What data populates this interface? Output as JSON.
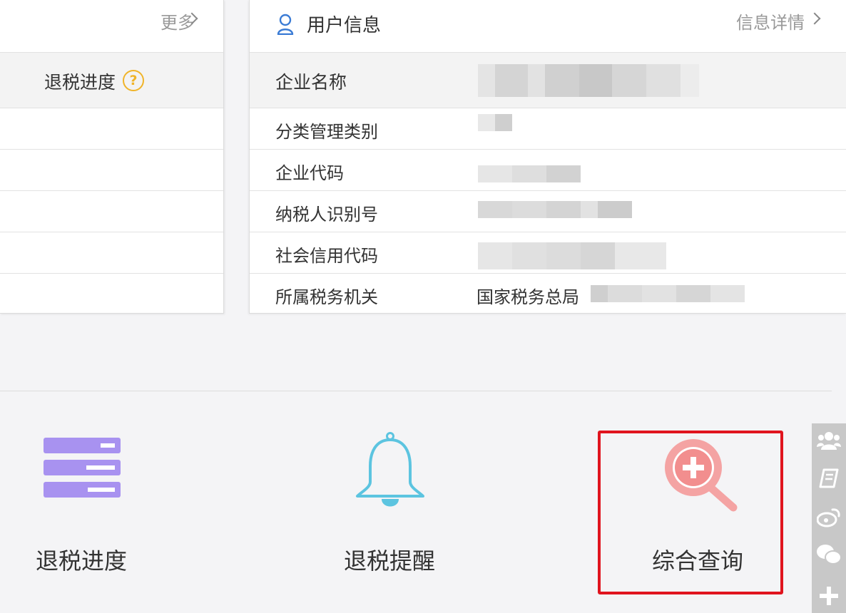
{
  "left_panel": {
    "more_label": "更多",
    "column_header": "退税进度",
    "help_glyph": "?",
    "rows": [
      "",
      "",
      "",
      "",
      ""
    ]
  },
  "user_info": {
    "title": "用户信息",
    "detail_link": "信息详情",
    "rows": [
      {
        "label": "企业名称",
        "value": ""
      },
      {
        "label": "分类管理类别",
        "value": ""
      },
      {
        "label": "企业代码",
        "value": ""
      },
      {
        "label": "纳税人识别号",
        "value": ""
      },
      {
        "label": "社会信用代码",
        "value": ""
      },
      {
        "label": "所属税务机关",
        "value": "国家税务总局"
      }
    ]
  },
  "actions": [
    {
      "label": "退税进度",
      "icon": "list-icon",
      "color": "#a892f0"
    },
    {
      "label": "退税提醒",
      "icon": "bell-icon",
      "color": "#5cc4e0"
    },
    {
      "label": "综合查询",
      "icon": "search-plus-icon",
      "color": "#f28e8e",
      "highlighted": true
    }
  ],
  "highlight_color": "#e0141e",
  "toolbar": {
    "buttons": [
      "group-icon",
      "book-icon",
      "weibo-icon",
      "wechat-icon",
      "plus-icon"
    ]
  }
}
